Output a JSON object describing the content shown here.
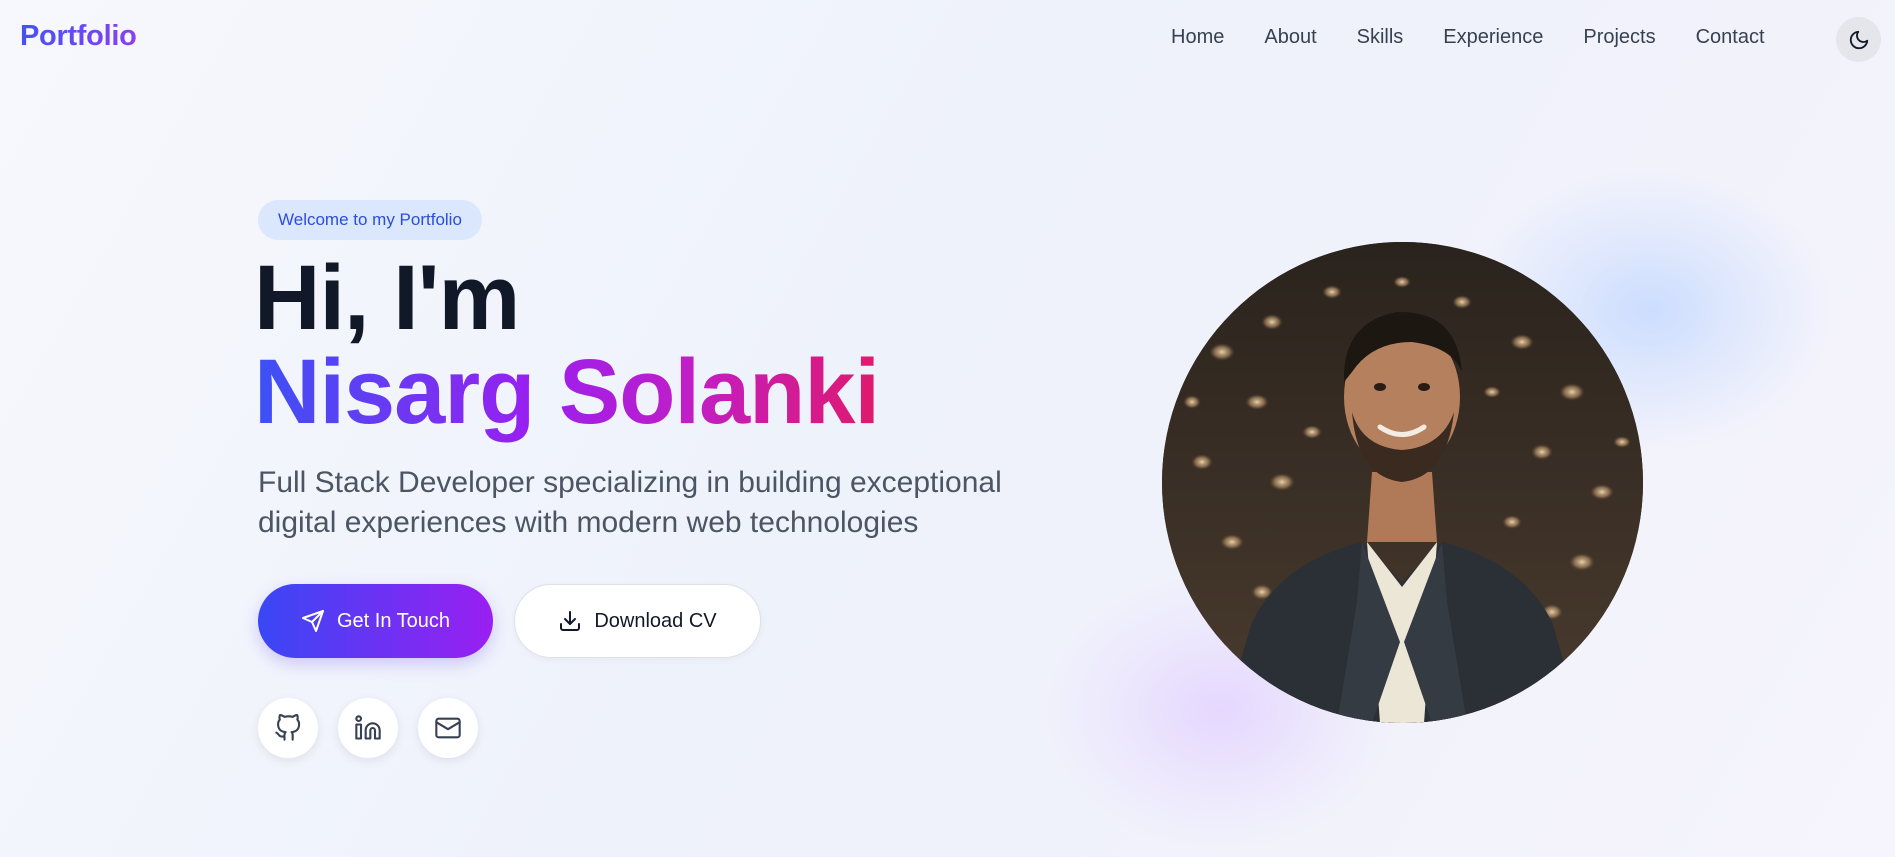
{
  "header": {
    "logo": "Portfolio",
    "nav": [
      "Home",
      "About",
      "Skills",
      "Experience",
      "Projects",
      "Contact"
    ],
    "theme_toggle_icon": "moon-icon"
  },
  "hero": {
    "badge": "Welcome to my Portfolio",
    "greeting": "Hi, I'm",
    "name": "Nisarg Solanki",
    "tagline": "Full Stack Developer specializing in building exceptional digital experiences with modern web technologies",
    "primary_button": {
      "label": "Get In Touch",
      "icon": "send-icon"
    },
    "secondary_button": {
      "label": "Download CV",
      "icon": "download-icon"
    },
    "socials": [
      {
        "icon": "github-icon"
      },
      {
        "icon": "linkedin-icon"
      },
      {
        "icon": "mail-icon"
      }
    ]
  },
  "colors": {
    "gradient_start": "#3b52f5",
    "gradient_mid": "#9a1ff0",
    "gradient_end": "#e0196c",
    "text_dark": "#111827",
    "text_muted": "#4b5563",
    "badge_bg": "#dbe7fd",
    "badge_text": "#2a4ed9"
  }
}
